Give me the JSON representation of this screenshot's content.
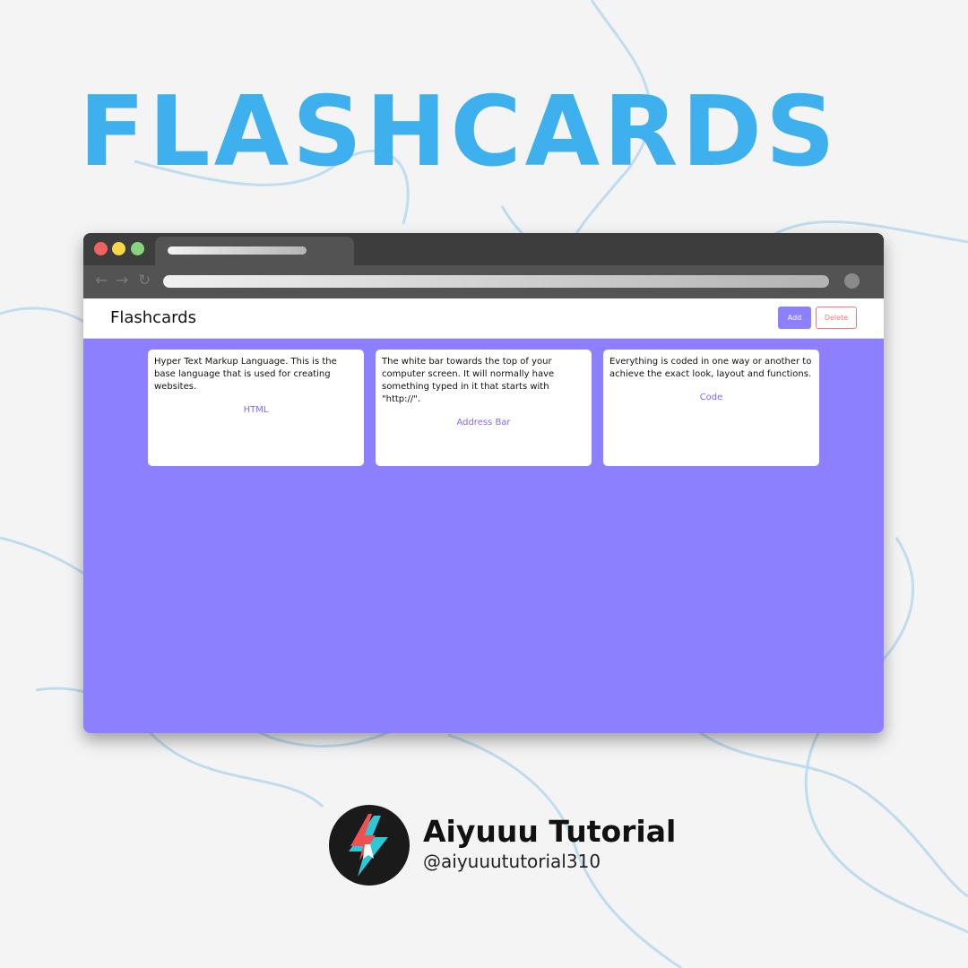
{
  "poster_title": "FLASHCARDS",
  "app": {
    "title": "Flashcards",
    "add_label": "Add",
    "delete_label": "Delete",
    "background_color": "#8c80ff"
  },
  "cards": [
    {
      "question": "Hyper Text Markup Language. This is the base language that is used for creating websites.",
      "answer": "HTML"
    },
    {
      "question": "The white bar towards the top of your computer screen. It will normally have something typed in it that starts with \"http://\".",
      "answer": "Address Bar"
    },
    {
      "question": "Everything is coded in one way or another to achieve the exact look, layout and functions.",
      "answer": "Code"
    }
  ],
  "browser": {
    "window_controls": [
      "close-icon",
      "minimize-icon",
      "maximize-icon"
    ],
    "nav_icons": [
      "back-arrow-icon",
      "forward-arrow-icon",
      "reload-icon"
    ]
  },
  "channel": {
    "name": "Aiyuuu Tutorial",
    "handle": "@aiyuuututorial310"
  },
  "colors": {
    "title_blue": "#3fb0ee",
    "app_purple": "#8c80ff",
    "delete_red": "#f07a7a"
  }
}
